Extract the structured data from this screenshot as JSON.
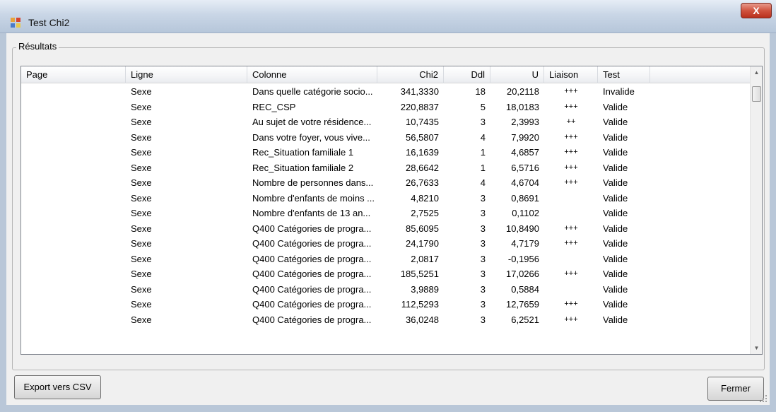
{
  "window": {
    "title": "Test Chi2",
    "close_label": "X"
  },
  "group": {
    "label": "Résultats"
  },
  "columns": [
    "Page",
    "Ligne",
    "Colonne",
    "Chi2",
    "Ddl",
    "U",
    "Liaison",
    "Test"
  ],
  "rows": [
    [
      "",
      "Sexe",
      "Dans quelle catégorie socio...",
      "341,3330",
      "18",
      "20,2118",
      "+++",
      "Invalide"
    ],
    [
      "",
      "Sexe",
      "REC_CSP",
      "220,8837",
      "5",
      "18,0183",
      "+++",
      "Valide"
    ],
    [
      "",
      "Sexe",
      "Au sujet de votre résidence...",
      "10,7435",
      "3",
      "2,3993",
      "++",
      "Valide"
    ],
    [
      "",
      "Sexe",
      "Dans votre foyer, vous vive...",
      "56,5807",
      "4",
      "7,9920",
      "+++",
      "Valide"
    ],
    [
      "",
      "Sexe",
      "Rec_Situation familiale 1",
      "16,1639",
      "1",
      "4,6857",
      "+++",
      "Valide"
    ],
    [
      "",
      "Sexe",
      "Rec_Situation familiale 2",
      "28,6642",
      "1",
      "6,5716",
      "+++",
      "Valide"
    ],
    [
      "",
      "Sexe",
      "Nombre de personnes dans...",
      "26,7633",
      "4",
      "4,6704",
      "+++",
      "Valide"
    ],
    [
      "",
      "Sexe",
      "Nombre d'enfants de moins ...",
      "4,8210",
      "3",
      "0,8691",
      "",
      "Valide"
    ],
    [
      "",
      "Sexe",
      "Nombre d'enfants de  13 an...",
      "2,7525",
      "3",
      "0,1102",
      "",
      "Valide"
    ],
    [
      "",
      "Sexe",
      "Q400  Catégories de progra...",
      "85,6095",
      "3",
      "10,8490",
      "+++",
      "Valide"
    ],
    [
      "",
      "Sexe",
      "Q400  Catégories de progra...",
      "24,1790",
      "3",
      "4,7179",
      "+++",
      "Valide"
    ],
    [
      "",
      "Sexe",
      "Q400  Catégories de progra...",
      "2,0817",
      "3",
      "-0,1956",
      "",
      "Valide"
    ],
    [
      "",
      "Sexe",
      "Q400  Catégories de progra...",
      "185,5251",
      "3",
      "17,0266",
      "+++",
      "Valide"
    ],
    [
      "",
      "Sexe",
      "Q400  Catégories de progra...",
      "3,9889",
      "3",
      "0,5884",
      "",
      "Valide"
    ],
    [
      "",
      "Sexe",
      "Q400  Catégories de progra...",
      "112,5293",
      "3",
      "12,7659",
      "+++",
      "Valide"
    ],
    [
      "",
      "Sexe",
      "Q400  Catégories de progra...",
      "36,0248",
      "3",
      "6,2521",
      "+++",
      "Valide"
    ]
  ],
  "buttons": {
    "export": "Export vers CSV",
    "close": "Fermer"
  },
  "icons": {
    "app": "app-window-icon",
    "close": "close-icon",
    "up": "scroll-up-arrow-icon",
    "down": "scroll-down-arrow-icon",
    "grip": "resize-grip-icon"
  }
}
